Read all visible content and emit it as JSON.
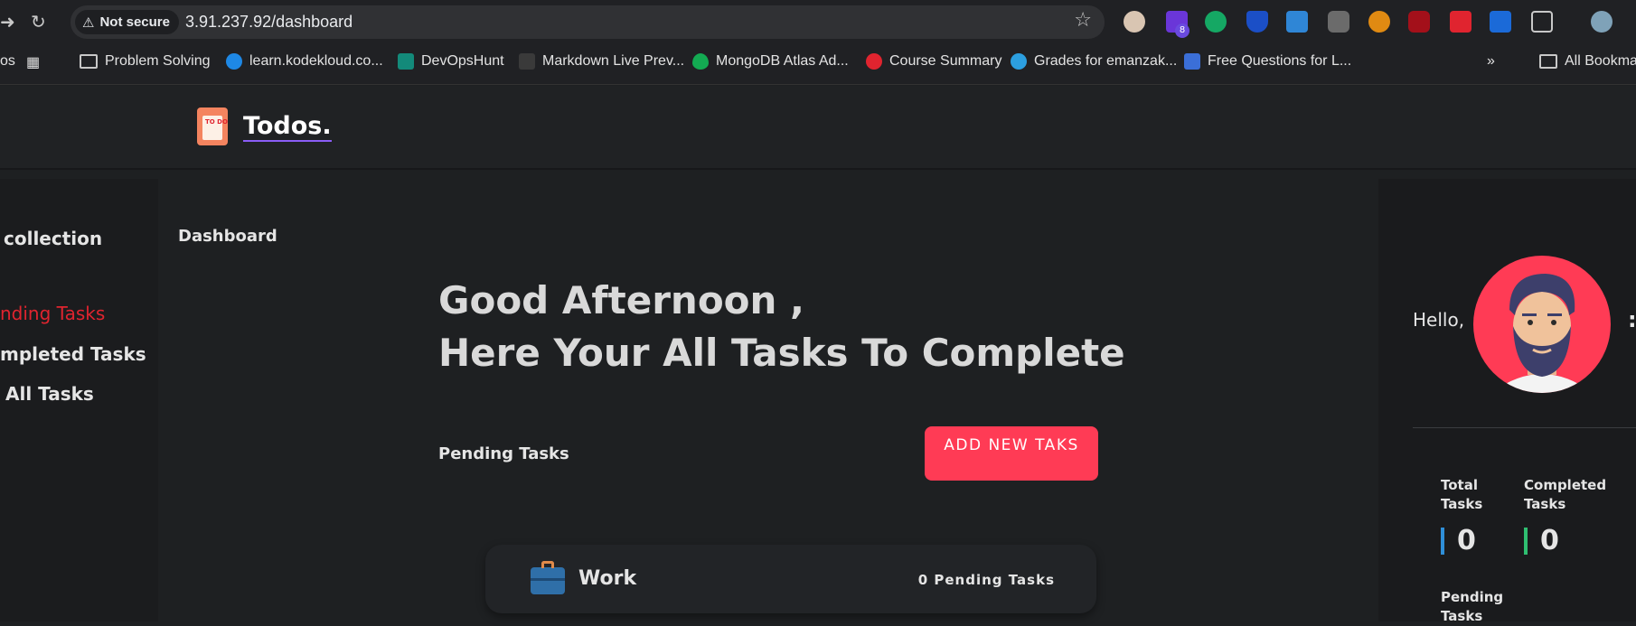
{
  "browser": {
    "back_icon": "back-arrow-icon",
    "reload_icon": "reload-icon",
    "security_label": "Not secure",
    "url": "3.91.237.92/dashboard",
    "ext_badge": "8"
  },
  "bookmarks": {
    "cut_label": "os",
    "items": [
      {
        "label": "Problem Solving"
      },
      {
        "label": "learn.kodekloud.co..."
      },
      {
        "label": "DevOpsHunt"
      },
      {
        "label": "Markdown Live Prev..."
      },
      {
        "label": "MongoDB Atlas Ad..."
      },
      {
        "label": "Course Summary"
      },
      {
        "label": "Grades for emanzak..."
      },
      {
        "label": "Free Questions for L..."
      }
    ],
    "all_bookmarks": "All Bookma"
  },
  "app": {
    "logo_text": "Todos.",
    "logo_badge": "TO DO"
  },
  "sidebar": {
    "collection": "collection",
    "pending": "nding Tasks",
    "completed": "mpleted Tasks",
    "all": "All Tasks"
  },
  "main": {
    "breadcrumb": "Dashboard",
    "greeting_line1": "Good Afternoon ,",
    "greeting_line2": "Here Your All Tasks To Complete",
    "section_title": "Pending Tasks",
    "add_button": "ADD NEW TAKS",
    "card": {
      "title": "Work",
      "count": "0 Pending Tasks"
    }
  },
  "profile": {
    "hello": "Hello,",
    "menu": ":",
    "stats": [
      {
        "label": "Total Tasks",
        "value": "0",
        "color": "#2f8fd8"
      },
      {
        "label": "Completed Tasks",
        "value": "0",
        "color": "#2fbf71"
      },
      {
        "label": "Pending Tasks"
      }
    ]
  },
  "colors": {
    "accent": "#ff3b55",
    "sidebar_active": "#e0242f"
  }
}
